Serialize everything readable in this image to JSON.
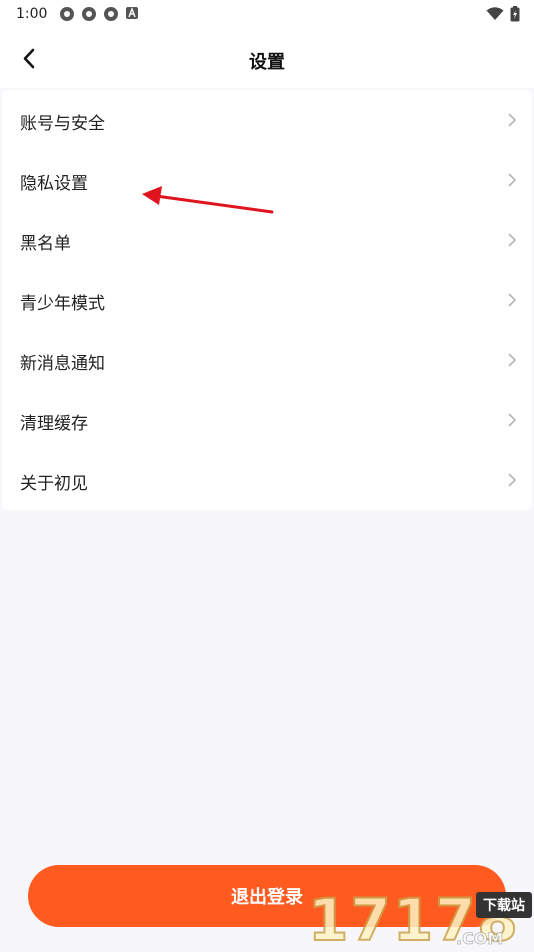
{
  "status_bar": {
    "time": "1:00",
    "left_icons": [
      "app-notification-icon",
      "app-notification-icon",
      "app-notification-icon",
      "a-badge-icon"
    ],
    "right_icons": [
      "wifi-icon",
      "battery-charging-icon"
    ]
  },
  "header": {
    "title": "设置",
    "back_icon": "chevron-left-icon"
  },
  "menu": {
    "items": [
      {
        "label": "账号与安全"
      },
      {
        "label": "隐私设置"
      },
      {
        "label": "黑名单"
      },
      {
        "label": "青少年模式"
      },
      {
        "label": "新消息通知"
      },
      {
        "label": "清理缓存"
      },
      {
        "label": "关于初见"
      }
    ]
  },
  "logout": {
    "label": "退出登录"
  },
  "watermark": {
    "text": "17178",
    "domain": ".COM",
    "tag": "下载站"
  },
  "colors": {
    "accent": "#ff5a1f",
    "background": "#f7f7fb",
    "annotation_arrow": "#e0141e"
  }
}
